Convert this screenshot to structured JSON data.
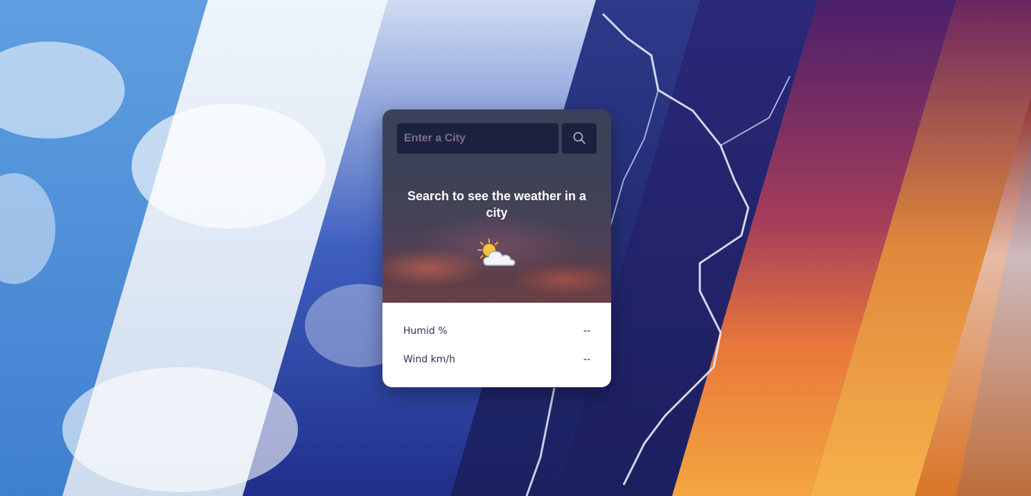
{
  "search": {
    "placeholder": "Enter a City",
    "button_icon": "search-icon"
  },
  "message": "Search to see the weather in a city",
  "weather_icon": "sun-behind-cloud-icon",
  "stats": [
    {
      "label": "Humid %",
      "value": "--"
    },
    {
      "label": "Wind km/h",
      "value": "--"
    }
  ],
  "colors": {
    "input_bg": "#1b2240",
    "card_bottom_bg": "#ffffff",
    "label_text": "#3a2f55"
  }
}
